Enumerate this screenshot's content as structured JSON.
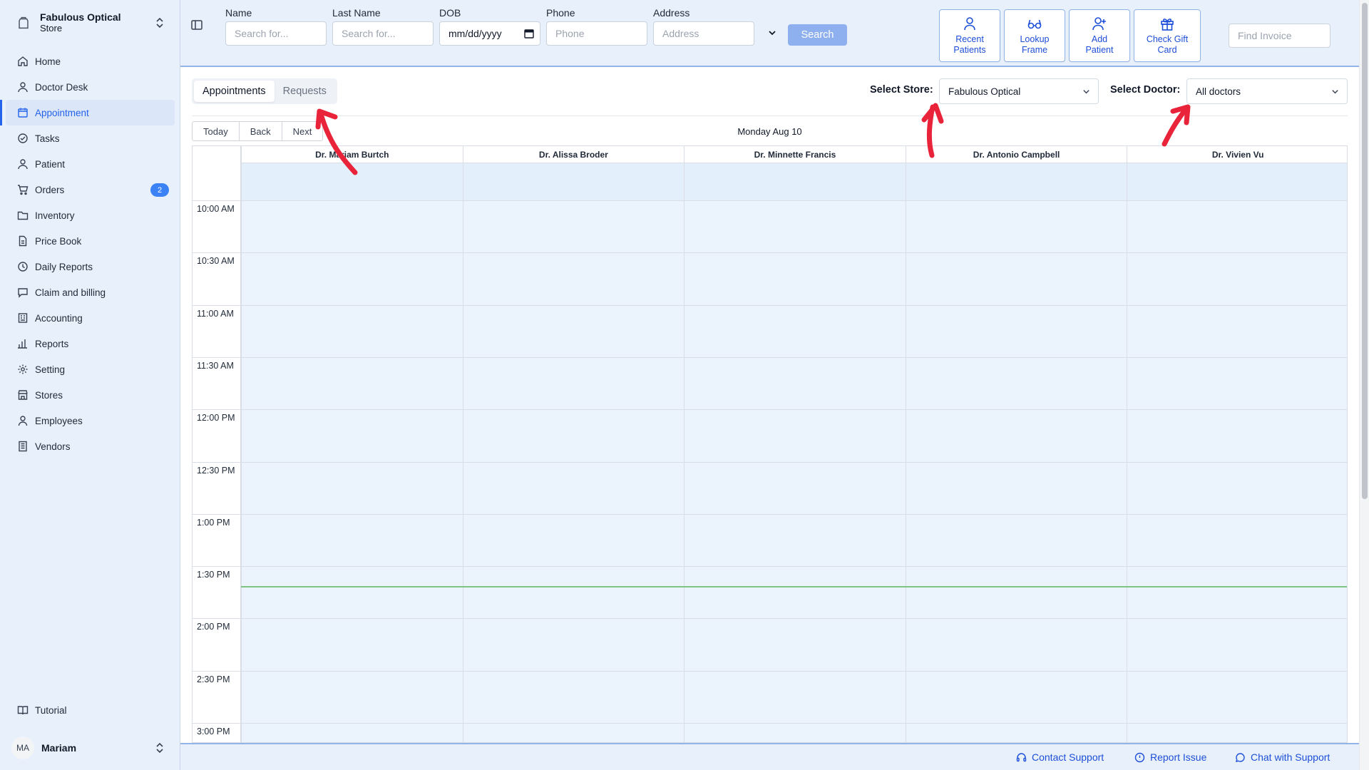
{
  "store": {
    "name": "Fabulous Optical",
    "sub": "Store"
  },
  "nav": {
    "items": [
      {
        "label": "Home",
        "icon": "home-icon"
      },
      {
        "label": "Doctor Desk",
        "icon": "doctor-icon"
      },
      {
        "label": "Appointment",
        "icon": "calendar-icon",
        "active": true
      },
      {
        "label": "Tasks",
        "icon": "check-circle-icon"
      },
      {
        "label": "Patient",
        "icon": "patient-icon"
      },
      {
        "label": "Orders",
        "icon": "cart-icon",
        "badge": "2"
      },
      {
        "label": "Inventory",
        "icon": "folder-icon"
      },
      {
        "label": "Price Book",
        "icon": "document-icon"
      },
      {
        "label": "Daily Reports",
        "icon": "history-icon"
      },
      {
        "label": "Claim and billing",
        "icon": "message-icon"
      },
      {
        "label": "Accounting",
        "icon": "building-icon"
      },
      {
        "label": "Reports",
        "icon": "bar-chart-icon"
      },
      {
        "label": "Setting",
        "icon": "gear-icon"
      },
      {
        "label": "Stores",
        "icon": "store-icon"
      },
      {
        "label": "Employees",
        "icon": "user-icon"
      },
      {
        "label": "Vendors",
        "icon": "vendor-icon"
      }
    ],
    "tutorial": "Tutorial"
  },
  "user": {
    "initials": "MA",
    "name": "Mariam"
  },
  "search": {
    "name_label": "Name",
    "name_placeholder": "Search for...",
    "last_label": "Last Name",
    "last_placeholder": "Search for...",
    "dob_label": "DOB",
    "dob_value": "mm/dd/yyyy",
    "phone_label": "Phone",
    "phone_placeholder": "Phone",
    "address_label": "Address",
    "address_placeholder": "Address",
    "button": "Search"
  },
  "toolbar": {
    "recent_line1": "Recent",
    "recent_line2": "Patients",
    "lookup_line1": "Lookup",
    "lookup_line2": "Frame",
    "add_line1": "Add",
    "add_line2": "Patient",
    "gift_line1": "Check Gift",
    "gift_line2": "Card",
    "find_invoice": "Find Invoice"
  },
  "tabs": {
    "appointments": "Appointments",
    "requests": "Requests"
  },
  "filters": {
    "store_label": "Select Store:",
    "store_value": "Fabulous Optical",
    "doctor_label": "Select Doctor:",
    "doctor_value": "All doctors"
  },
  "calendar": {
    "today": "Today",
    "back": "Back",
    "next": "Next",
    "date": "Monday Aug 10",
    "doctors": [
      "Dr. Mariam Burtch",
      "Dr. Alissa Broder",
      "Dr. Minnette Francis",
      "Dr. Antonio Campbell",
      "Dr. Vivien Vu"
    ],
    "times": [
      "10:00 AM",
      "10:30 AM",
      "11:00 AM",
      "11:30 AM",
      "12:00 PM",
      "12:30 PM",
      "1:00 PM",
      "1:30 PM",
      "2:00 PM",
      "2:30 PM",
      "3:00 PM"
    ],
    "now_fraction": 0.71
  },
  "footer": {
    "contact": "Contact Support",
    "report": "Report Issue",
    "chat": "Chat with Support"
  },
  "colors": {
    "accent": "#2563eb",
    "sidebar_bg": "#e8f0fb",
    "cal_slot": "#ebf4fd",
    "annotation": "#e8233a",
    "now_line": "#7cc47f"
  }
}
